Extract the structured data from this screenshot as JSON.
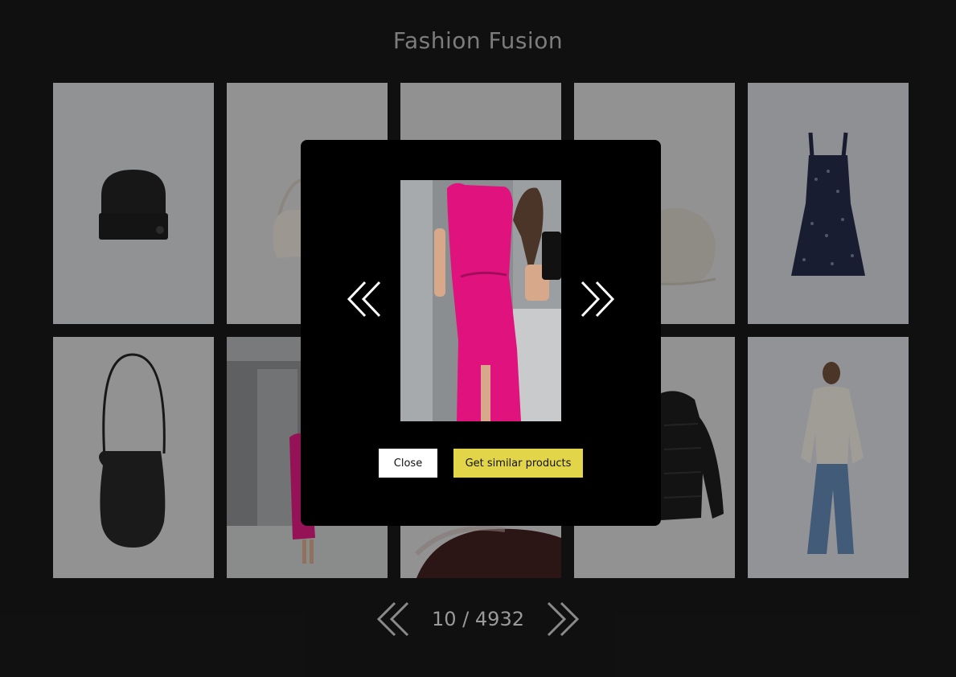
{
  "app": {
    "title": "Fashion Fusion"
  },
  "gallery": {
    "items": [
      {
        "icon": "black-beanie-photo"
      },
      {
        "icon": "white-shoulder-bag-photo"
      },
      {
        "icon": "grey-backdrop-photo"
      },
      {
        "icon": "beige-flat-cap-photo"
      },
      {
        "icon": "floral-dress-photo"
      },
      {
        "icon": "black-woven-bag-photo"
      },
      {
        "icon": "elevator-pink-dress-photo"
      },
      {
        "icon": "brown-fabric-photo"
      },
      {
        "icon": "black-puffer-jacket-photo"
      },
      {
        "icon": "cream-jacket-jeans-model-photo"
      }
    ]
  },
  "pagination": {
    "counter": "10 / 4932",
    "prev_icon": "double-chevron-left-icon",
    "next_icon": "double-chevron-right-icon"
  },
  "modal": {
    "image_icon": "pink-dress-elevator-selfie-photo",
    "prev_icon": "double-chevron-left-icon",
    "next_icon": "double-chevron-right-icon",
    "close_label": "Close",
    "similar_label": "Get similar products"
  },
  "colors": {
    "background": "#111111",
    "modal_bg": "#000000",
    "accent_button": "#e3d54a",
    "dress_pink": "#e0137e"
  }
}
